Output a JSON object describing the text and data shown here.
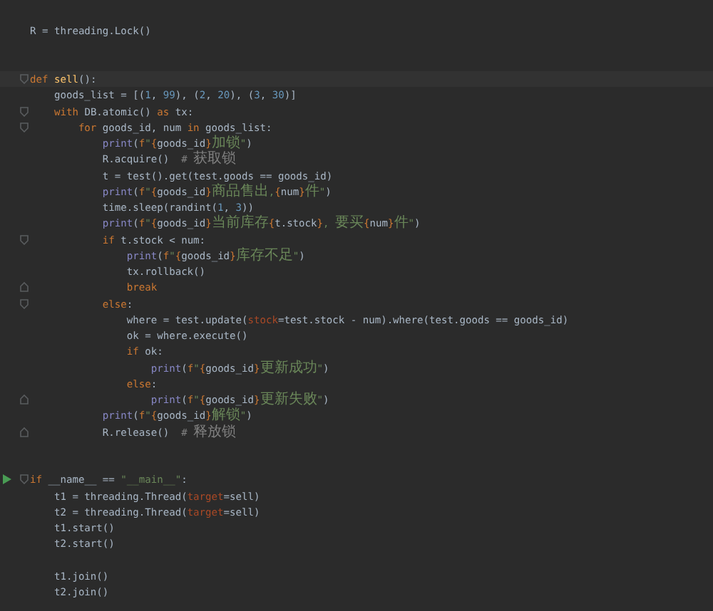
{
  "editor": {
    "lines": [
      {
        "kind": "blank"
      },
      {
        "kind": "code",
        "tokens": [
          {
            "kind": "plain",
            "text": "R = threading.Lock()"
          }
        ]
      },
      {
        "kind": "blank"
      },
      {
        "kind": "blank"
      },
      {
        "kind": "code",
        "current": true,
        "fold_start": true,
        "tokens": [
          {
            "kind": "kw",
            "text": "def "
          },
          {
            "kind": "def",
            "text": "sell"
          },
          {
            "kind": "plain",
            "text": "():"
          }
        ]
      },
      {
        "kind": "code",
        "tokens": [
          {
            "kind": "plain",
            "text": "    goods_list = [("
          },
          {
            "kind": "num",
            "text": "1"
          },
          {
            "kind": "plain",
            "text": ", "
          },
          {
            "kind": "num",
            "text": "99"
          },
          {
            "kind": "plain",
            "text": "), ("
          },
          {
            "kind": "num",
            "text": "2"
          },
          {
            "kind": "plain",
            "text": ", "
          },
          {
            "kind": "num",
            "text": "20"
          },
          {
            "kind": "plain",
            "text": "), ("
          },
          {
            "kind": "num",
            "text": "3"
          },
          {
            "kind": "plain",
            "text": ", "
          },
          {
            "kind": "num",
            "text": "30"
          },
          {
            "kind": "plain",
            "text": ")]"
          }
        ]
      },
      {
        "kind": "code",
        "fold_start": true,
        "tokens": [
          {
            "kind": "kw",
            "text": "    with"
          },
          {
            "kind": "plain",
            "text": " DB.atomic() "
          },
          {
            "kind": "kw",
            "text": "as"
          },
          {
            "kind": "plain",
            "text": " tx:"
          }
        ]
      },
      {
        "kind": "code",
        "fold_start": true,
        "tokens": [
          {
            "kind": "kw",
            "text": "        for"
          },
          {
            "kind": "plain",
            "text": " goods_id, num "
          },
          {
            "kind": "kw",
            "text": "in"
          },
          {
            "kind": "plain",
            "text": " goods_list:"
          }
        ]
      },
      {
        "kind": "code",
        "tokens": [
          {
            "kind": "fn",
            "text": "            print"
          },
          {
            "kind": "plain",
            "text": "("
          },
          {
            "kind": "kw",
            "text": "f"
          },
          {
            "kind": "str",
            "text": "\""
          },
          {
            "kind": "brace",
            "text": "{"
          },
          {
            "kind": "plain",
            "text": "goods_id"
          },
          {
            "kind": "brace",
            "text": "}"
          },
          {
            "kind": "str",
            "text": "加锁\""
          },
          {
            "kind": "plain",
            "text": ")"
          }
        ]
      },
      {
        "kind": "code",
        "tokens": [
          {
            "kind": "plain",
            "text": "            R.acquire()  "
          },
          {
            "kind": "cmt",
            "text": "# 获取锁"
          }
        ]
      },
      {
        "kind": "code",
        "tokens": [
          {
            "kind": "plain",
            "text": "            t = test().get(test.goods == goods_id)"
          }
        ]
      },
      {
        "kind": "code",
        "tokens": [
          {
            "kind": "fn",
            "text": "            print"
          },
          {
            "kind": "plain",
            "text": "("
          },
          {
            "kind": "kw",
            "text": "f"
          },
          {
            "kind": "str",
            "text": "\""
          },
          {
            "kind": "brace",
            "text": "{"
          },
          {
            "kind": "plain",
            "text": "goods_id"
          },
          {
            "kind": "brace",
            "text": "}"
          },
          {
            "kind": "str",
            "text": "商品售出,"
          },
          {
            "kind": "brace",
            "text": "{"
          },
          {
            "kind": "plain",
            "text": "num"
          },
          {
            "kind": "brace",
            "text": "}"
          },
          {
            "kind": "str",
            "text": "件\""
          },
          {
            "kind": "plain",
            "text": ")"
          }
        ]
      },
      {
        "kind": "code",
        "tokens": [
          {
            "kind": "plain",
            "text": "            time.sleep(randint("
          },
          {
            "kind": "num",
            "text": "1"
          },
          {
            "kind": "plain",
            "text": ", "
          },
          {
            "kind": "num",
            "text": "3"
          },
          {
            "kind": "plain",
            "text": "))"
          }
        ]
      },
      {
        "kind": "code",
        "tokens": [
          {
            "kind": "fn",
            "text": "            print"
          },
          {
            "kind": "plain",
            "text": "("
          },
          {
            "kind": "kw",
            "text": "f"
          },
          {
            "kind": "str",
            "text": "\""
          },
          {
            "kind": "brace",
            "text": "{"
          },
          {
            "kind": "plain",
            "text": "goods_id"
          },
          {
            "kind": "brace",
            "text": "}"
          },
          {
            "kind": "str",
            "text": "当前库存"
          },
          {
            "kind": "brace",
            "text": "{"
          },
          {
            "kind": "plain",
            "text": "t.stock"
          },
          {
            "kind": "brace",
            "text": "}"
          },
          {
            "kind": "str",
            "text": ", 要买"
          },
          {
            "kind": "brace",
            "text": "{"
          },
          {
            "kind": "plain",
            "text": "num"
          },
          {
            "kind": "brace",
            "text": "}"
          },
          {
            "kind": "str",
            "text": "件\""
          },
          {
            "kind": "plain",
            "text": ")"
          }
        ]
      },
      {
        "kind": "code",
        "fold_start": true,
        "tokens": [
          {
            "kind": "kw",
            "text": "            if"
          },
          {
            "kind": "plain",
            "text": " t.stock < num:"
          }
        ]
      },
      {
        "kind": "code",
        "tokens": [
          {
            "kind": "fn",
            "text": "                print"
          },
          {
            "kind": "plain",
            "text": "("
          },
          {
            "kind": "kw",
            "text": "f"
          },
          {
            "kind": "str",
            "text": "\""
          },
          {
            "kind": "brace",
            "text": "{"
          },
          {
            "kind": "plain",
            "text": "goods_id"
          },
          {
            "kind": "brace",
            "text": "}"
          },
          {
            "kind": "str",
            "text": "库存不足\""
          },
          {
            "kind": "plain",
            "text": ")"
          }
        ]
      },
      {
        "kind": "code",
        "tokens": [
          {
            "kind": "plain",
            "text": "                tx.rollback()"
          }
        ]
      },
      {
        "kind": "code",
        "fold_end": true,
        "tokens": [
          {
            "kind": "kw",
            "text": "                break"
          }
        ]
      },
      {
        "kind": "code",
        "fold_start": true,
        "tokens": [
          {
            "kind": "kw",
            "text": "            else"
          },
          {
            "kind": "plain",
            "text": ":"
          }
        ]
      },
      {
        "kind": "code",
        "tokens": [
          {
            "kind": "plain",
            "text": "                where = test.update("
          },
          {
            "kind": "param",
            "text": "stock"
          },
          {
            "kind": "plain",
            "text": "=test.stock - num).where(test.goods == goods_id)"
          }
        ]
      },
      {
        "kind": "code",
        "tokens": [
          {
            "kind": "plain",
            "text": "                ok = where.execute()"
          }
        ]
      },
      {
        "kind": "code",
        "tokens": [
          {
            "kind": "kw",
            "text": "                if"
          },
          {
            "kind": "plain",
            "text": " ok:"
          }
        ]
      },
      {
        "kind": "code",
        "tokens": [
          {
            "kind": "fn",
            "text": "                    print"
          },
          {
            "kind": "plain",
            "text": "("
          },
          {
            "kind": "kw",
            "text": "f"
          },
          {
            "kind": "str",
            "text": "\""
          },
          {
            "kind": "brace",
            "text": "{"
          },
          {
            "kind": "plain",
            "text": "goods_id"
          },
          {
            "kind": "brace",
            "text": "}"
          },
          {
            "kind": "str",
            "text": "更新成功\""
          },
          {
            "kind": "plain",
            "text": ")"
          }
        ]
      },
      {
        "kind": "code",
        "tokens": [
          {
            "kind": "kw",
            "text": "                else"
          },
          {
            "kind": "plain",
            "text": ":"
          }
        ]
      },
      {
        "kind": "code",
        "fold_end": true,
        "tokens": [
          {
            "kind": "fn",
            "text": "                    print"
          },
          {
            "kind": "plain",
            "text": "("
          },
          {
            "kind": "kw",
            "text": "f"
          },
          {
            "kind": "str",
            "text": "\""
          },
          {
            "kind": "brace",
            "text": "{"
          },
          {
            "kind": "plain",
            "text": "goods_id"
          },
          {
            "kind": "brace",
            "text": "}"
          },
          {
            "kind": "str",
            "text": "更新失败\""
          },
          {
            "kind": "plain",
            "text": ")"
          }
        ]
      },
      {
        "kind": "code",
        "tokens": [
          {
            "kind": "fn",
            "text": "            print"
          },
          {
            "kind": "plain",
            "text": "("
          },
          {
            "kind": "kw",
            "text": "f"
          },
          {
            "kind": "str",
            "text": "\""
          },
          {
            "kind": "brace",
            "text": "{"
          },
          {
            "kind": "plain",
            "text": "goods_id"
          },
          {
            "kind": "brace",
            "text": "}"
          },
          {
            "kind": "str",
            "text": "解锁\""
          },
          {
            "kind": "plain",
            "text": ")"
          }
        ]
      },
      {
        "kind": "code",
        "fold_end": true,
        "tokens": [
          {
            "kind": "plain",
            "text": "            R.release()  "
          },
          {
            "kind": "cmt",
            "text": "# 释放锁"
          }
        ]
      },
      {
        "kind": "blank"
      },
      {
        "kind": "blank"
      },
      {
        "kind": "code",
        "fold_start": true,
        "run": true,
        "tokens": [
          {
            "kind": "kw",
            "text": "if"
          },
          {
            "kind": "plain",
            "text": " __name__ == "
          },
          {
            "kind": "str",
            "text": "\"__main__\""
          },
          {
            "kind": "plain",
            "text": ":"
          }
        ]
      },
      {
        "kind": "code",
        "tokens": [
          {
            "kind": "plain",
            "text": "    t1 = threading.Thread("
          },
          {
            "kind": "param",
            "text": "target"
          },
          {
            "kind": "plain",
            "text": "=sell)"
          }
        ]
      },
      {
        "kind": "code",
        "tokens": [
          {
            "kind": "plain",
            "text": "    t2 = threading.Thread("
          },
          {
            "kind": "param",
            "text": "target"
          },
          {
            "kind": "plain",
            "text": "=sell)"
          }
        ]
      },
      {
        "kind": "code",
        "tokens": [
          {
            "kind": "plain",
            "text": "    t1.start()"
          }
        ]
      },
      {
        "kind": "code",
        "tokens": [
          {
            "kind": "plain",
            "text": "    t2.start()"
          }
        ]
      },
      {
        "kind": "blank"
      },
      {
        "kind": "code",
        "tokens": [
          {
            "kind": "plain",
            "text": "    t1.join()"
          }
        ]
      },
      {
        "kind": "code",
        "tokens": [
          {
            "kind": "plain",
            "text": "    t2.join()"
          }
        ]
      }
    ]
  }
}
